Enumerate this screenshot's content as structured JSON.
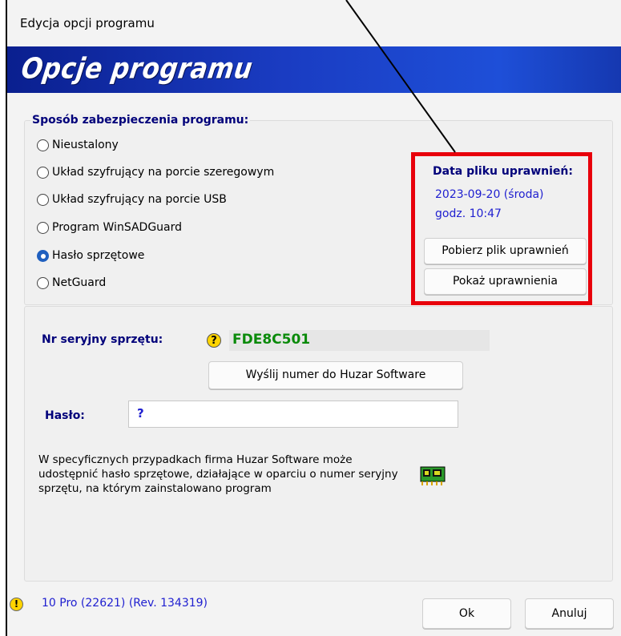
{
  "window": {
    "title": "Edycja opcji programu"
  },
  "banner": {
    "title": "Opcje programu"
  },
  "protection": {
    "title": "Sposób zabezpieczenia programu:",
    "options": [
      {
        "label": "Nieustalony",
        "checked": false
      },
      {
        "label": "Układ szyfrujący na porcie szeregowym",
        "checked": false
      },
      {
        "label": "Układ szyfrujący na porcie USB",
        "checked": false
      },
      {
        "label": "Program WinSADGuard",
        "checked": false
      },
      {
        "label": "Hasło sprzętowe",
        "checked": true
      },
      {
        "label": "NetGuard",
        "checked": false
      }
    ]
  },
  "permissions": {
    "title": "Data pliku uprawnień:",
    "date": "2023-09-20 (środa)",
    "time": "godz. 10:47",
    "download_button": "Pobierz plik uprawnień",
    "show_button": "Pokaż uprawnienia"
  },
  "hardware": {
    "serial_label": "Nr seryjny sprzętu:",
    "serial_value": "FDE8C501",
    "send_button": "Wyślij numer do Huzar Software",
    "password_label": "Hasło:",
    "password_value": "?",
    "info_text": "W specyficznych przypadkach firma Huzar Software może udostępnić hasło sprzętowe, działające w oparciu o numer seryjny sprzętu, na którym zainstalowano program"
  },
  "footer": {
    "version": "10 Pro (22621) (Rev. 134319)",
    "ok_button": "Ok",
    "cancel_button": "Anuluj"
  },
  "colors": {
    "highlight_border": "#e8000b",
    "banner": "#1a3cc2",
    "label": "#00007a",
    "serial": "#0a8a0a"
  },
  "icons": [
    "help-icon",
    "warning-icon",
    "hardware-chip-icon"
  ]
}
